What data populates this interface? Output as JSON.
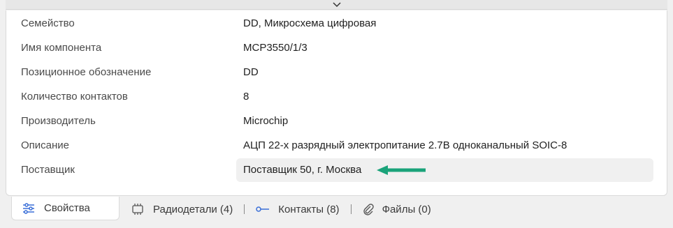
{
  "properties": {
    "rows": [
      {
        "label": "Семейство",
        "value": "DD, Микросхема цифровая"
      },
      {
        "label": "Имя компонента",
        "value": "MCP3550/1/3"
      },
      {
        "label": "Позиционное обозначение",
        "value": "DD"
      },
      {
        "label": "Количество контактов",
        "value": "8"
      },
      {
        "label": "Производитель",
        "value": "Microchip"
      },
      {
        "label": "Описание",
        "value": "АЦП 22-х разрядный электропитание 2.7В одноканальный SOIC-8"
      },
      {
        "label": "Поставщик",
        "value": "Поставщик 50, г. Москва"
      }
    ]
  },
  "tabs": {
    "properties": "Свойства",
    "parts": "Радиодетали (4)",
    "contacts": "Контакты (8)",
    "files": "Файлы (0)"
  },
  "icons": {
    "collapse": "chevron-down-icon",
    "properties": "sliders-icon",
    "parts": "chip-icon",
    "contacts": "pin-icon",
    "files": "paperclip-icon"
  },
  "colors": {
    "arrow": "#1aa37a",
    "highlight": "#f0f0f0"
  }
}
